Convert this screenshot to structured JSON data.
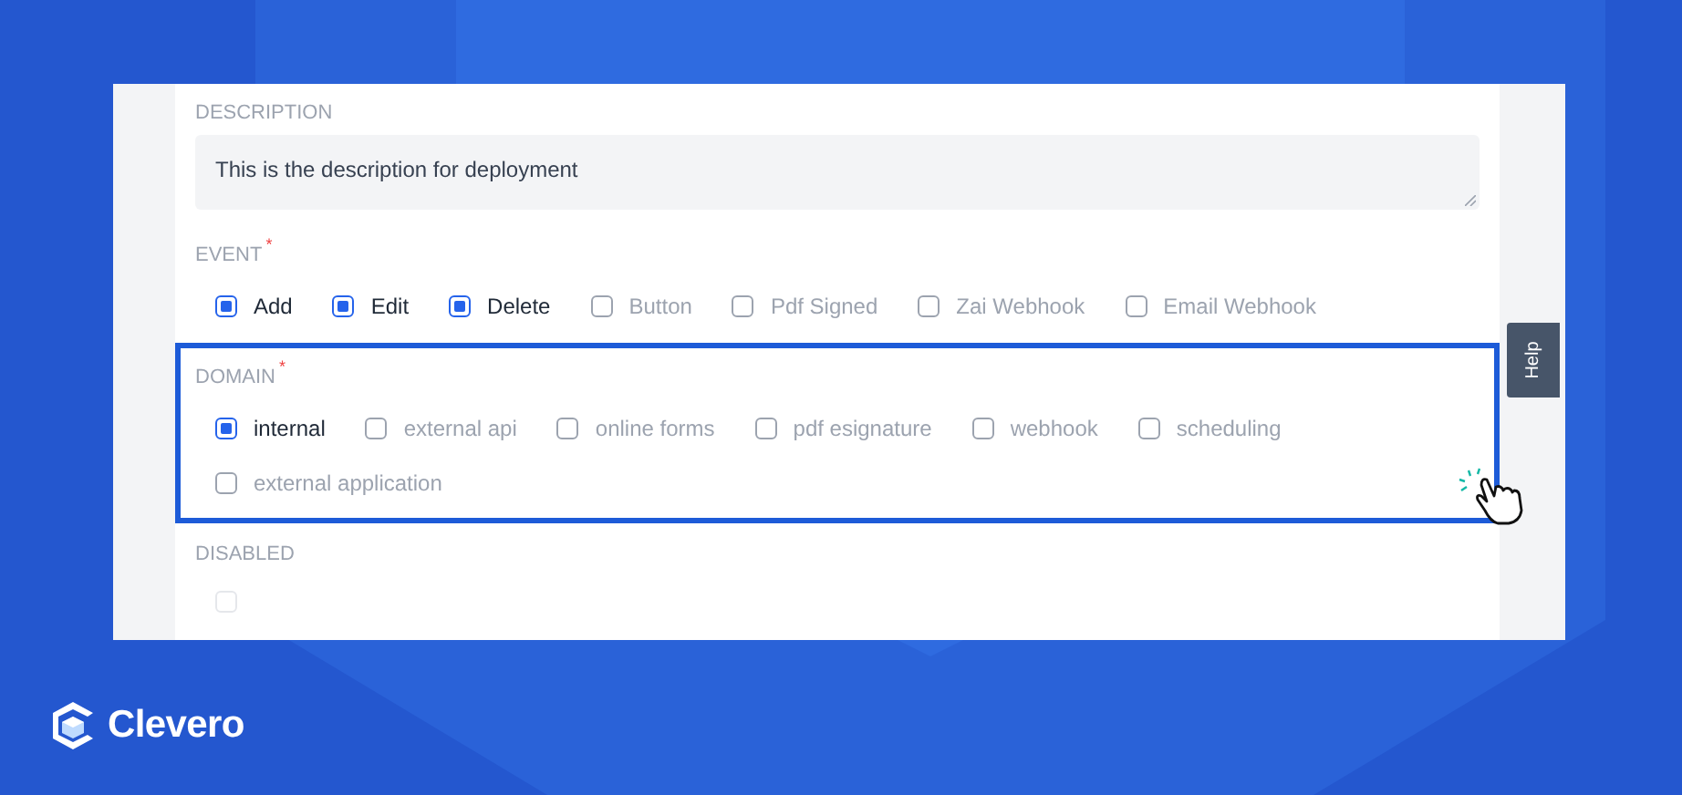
{
  "form": {
    "description": {
      "label": "DESCRIPTION",
      "value": "This is the description for deployment"
    },
    "event": {
      "label": "EVENT",
      "required_mark": "*",
      "options": [
        {
          "label": "Add",
          "checked": true
        },
        {
          "label": "Edit",
          "checked": true
        },
        {
          "label": "Delete",
          "checked": true
        },
        {
          "label": "Button",
          "checked": false
        },
        {
          "label": "Pdf Signed",
          "checked": false
        },
        {
          "label": "Zai Webhook",
          "checked": false
        },
        {
          "label": "Email Webhook",
          "checked": false
        }
      ]
    },
    "domain": {
      "label": "DOMAIN",
      "required_mark": "*",
      "highlighted": true,
      "options": [
        {
          "label": "internal",
          "checked": true
        },
        {
          "label": "external api",
          "checked": false
        },
        {
          "label": "online forms",
          "checked": false
        },
        {
          "label": "pdf esignature",
          "checked": false
        },
        {
          "label": "webhook",
          "checked": false
        },
        {
          "label": "scheduling",
          "checked": false
        },
        {
          "label": "external application",
          "checked": false
        }
      ]
    },
    "disabled": {
      "label": "DISABLED",
      "checked": false,
      "disabled": true
    }
  },
  "help_tab": "Help",
  "brand": "Clevero"
}
